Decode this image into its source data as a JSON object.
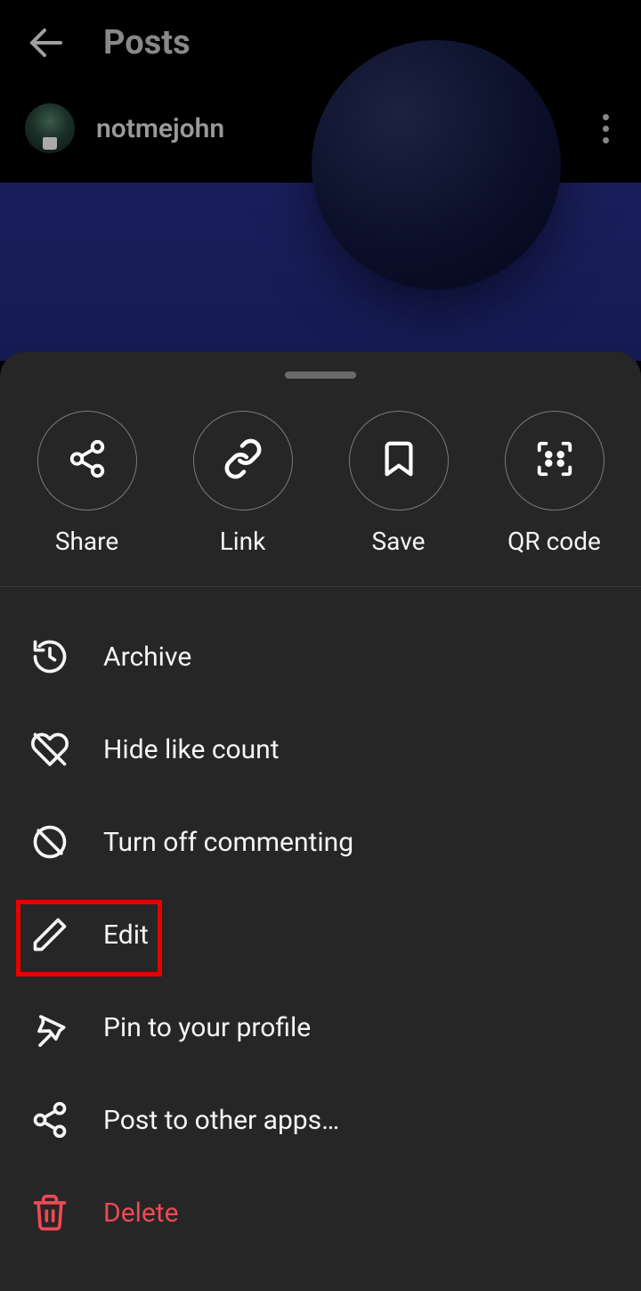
{
  "header": {
    "title": "Posts"
  },
  "user": {
    "name": "notmejohn"
  },
  "sheet": {
    "quick": [
      {
        "key": "share",
        "label": "Share"
      },
      {
        "key": "link",
        "label": "Link"
      },
      {
        "key": "save",
        "label": "Save"
      },
      {
        "key": "qr",
        "label": "QR code"
      }
    ],
    "menu": {
      "archive": "Archive",
      "hide_likes": "Hide like count",
      "turn_off_commenting": "Turn off commenting",
      "edit": "Edit",
      "pin": "Pin to your profile",
      "post_other": "Post to other apps…",
      "delete": "Delete"
    }
  },
  "highlight": {
    "target": "edit"
  }
}
